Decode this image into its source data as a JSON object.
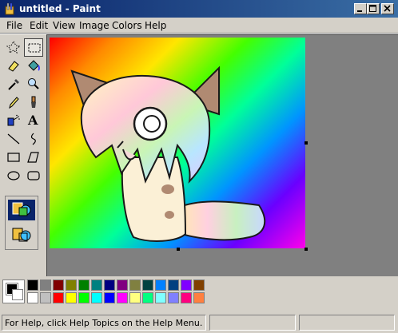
{
  "window": {
    "title": "untitled - Paint"
  },
  "menu": [
    "File",
    "Edit",
    "View",
    "Image",
    "Colors",
    "Help"
  ],
  "tools": [
    {
      "name": "free-form-select-tool-icon"
    },
    {
      "name": "rectangle-select-tool-icon",
      "selected": true
    },
    {
      "name": "eraser-tool-icon"
    },
    {
      "name": "fill-bucket-tool-icon"
    },
    {
      "name": "color-picker-tool-icon"
    },
    {
      "name": "magnifier-tool-icon"
    },
    {
      "name": "pencil-tool-icon"
    },
    {
      "name": "brush-tool-icon"
    },
    {
      "name": "airbrush-tool-icon"
    },
    {
      "name": "text-tool-icon"
    },
    {
      "name": "line-tool-icon"
    },
    {
      "name": "curve-tool-icon"
    },
    {
      "name": "rectangle-tool-icon"
    },
    {
      "name": "polygon-tool-icon"
    },
    {
      "name": "ellipse-tool-icon"
    },
    {
      "name": "rounded-rectangle-tool-icon"
    }
  ],
  "text_tool_label": "A",
  "palette": {
    "foreground": "#000000",
    "background": "#ffffff",
    "top_row": [
      "#000000",
      "#808080",
      "#800000",
      "#808000",
      "#008000",
      "#008080",
      "#000080",
      "#800080",
      "#808040",
      "#004040",
      "#0080ff",
      "#004080",
      "#8000ff",
      "#804000"
    ],
    "bottom_row": [
      "#ffffff",
      "#c0c0c0",
      "#ff0000",
      "#ffff00",
      "#00ff00",
      "#00ffff",
      "#0000ff",
      "#ff00ff",
      "#ffff80",
      "#00ff80",
      "#80ffff",
      "#8080ff",
      "#ff0080",
      "#ff8040"
    ]
  },
  "status": {
    "help_text": "For Help, click Help Topics on the Help Menu."
  }
}
